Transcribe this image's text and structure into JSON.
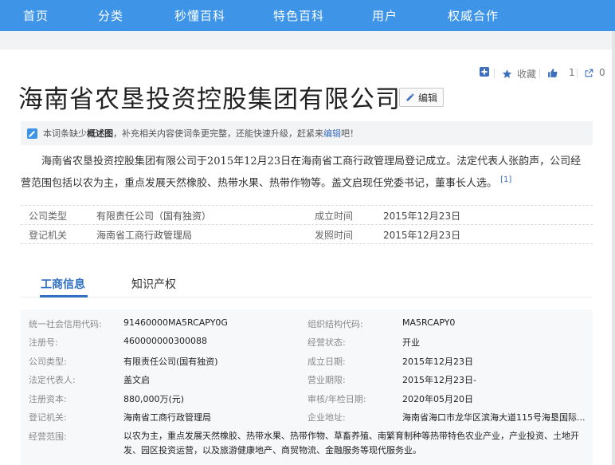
{
  "nav": {
    "items": [
      "首页",
      "分类",
      "秒懂百科",
      "特色百科",
      "用户",
      "权威合作"
    ]
  },
  "toolbar": {
    "collect_label": "收藏",
    "like_count": "1",
    "share_count": "0"
  },
  "title": "海南省农垦投资控股集团有限公司",
  "edit_label": "编辑",
  "notice": {
    "prefix": "本词条缺少",
    "strong": "概述图",
    "middle": "，补充相关内容使词条更完整，还能快速升级，赶紧来",
    "link": "编辑",
    "suffix": "吧！"
  },
  "summary": {
    "text": "海南省农垦投资控股集团有限公司于2015年12月23日在海南省工商行政管理局登记成立。法定代表人张韵声，公司经营范围包括以农为主，重点发展天然橡胶、热带水果、热带作物等。盖文启现任党委书记，董事长人选。",
    "ref": "[1]"
  },
  "basic_info": [
    {
      "k1": "公司类型",
      "v1": "有限责任公司（国有独资）",
      "k2": "成立时间",
      "v2": "2015年12月23日"
    },
    {
      "k1": "登记机关",
      "v1": "海南省工商行政管理局",
      "k2": "发照时间",
      "v2": "2015年12月23日"
    }
  ],
  "tabs": [
    "工商信息",
    "知识产权"
  ],
  "business_info": {
    "left": [
      {
        "k": "统一社会信用代码:",
        "v": "91460000MA5RCAPY0G"
      },
      {
        "k": "注册号:",
        "v": "460000000300088"
      },
      {
        "k": "公司类型:",
        "v": "有限责任公司(国有独资)"
      },
      {
        "k": "法定代表人:",
        "v": "盖文启"
      },
      {
        "k": "注册资本:",
        "v": "880,000万(元)"
      },
      {
        "k": "登记机关:",
        "v": "海南省工商行政管理局"
      }
    ],
    "right": [
      {
        "k": "组织结构代码:",
        "v": "MA5RCAPY0"
      },
      {
        "k": "经营状态:",
        "v": "开业"
      },
      {
        "k": "成立日期:",
        "v": "2015年12月23日"
      },
      {
        "k": "营业期限:",
        "v": "2015年12月23日-"
      },
      {
        "k": "审核/年检日期:",
        "v": "2020年05月20日"
      },
      {
        "k": "企业地址:",
        "v": "海南省海口市龙华区滨海大道115号海垦国际..."
      }
    ],
    "scope_label": "经营范围:",
    "scope_value": "以农为主，重点发展天然橡胶、热带水果、热带作物、草畜养殖、南繁育制种等热带特色农业产业，产业投资、土地开发、园区投资运营，以及旅游健康地产、商贸物流、金融服务等现代服务业。"
  },
  "colors": {
    "nav_bg": "#3e95e8",
    "accent_blue": "#2f6fc2",
    "link_blue": "#3e6fbc"
  }
}
